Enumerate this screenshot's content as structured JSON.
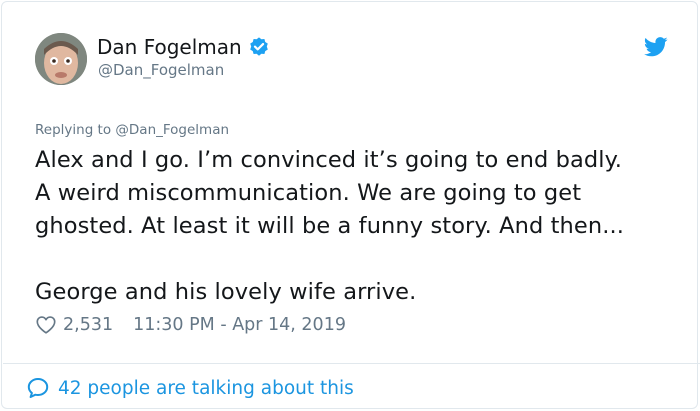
{
  "tweet": {
    "author": {
      "name": "Dan Fogelman",
      "handle": "@Dan_Fogelman",
      "verified": true
    },
    "replying_to_prefix": "Replying to",
    "replying_to_handle": "@Dan_Fogelman",
    "text_lines": [
      "Alex and I go. I’m convinced it’s going to end badly.",
      "A weird miscommunication.  We are going to get",
      "ghosted. At least it will be a funny story. And then...",
      "George and his lovely wife arrive."
    ],
    "likes": "2,531",
    "timestamp": "11:30 PM - Apr 14, 2019",
    "talking": "42 people are talking about this"
  },
  "colors": {
    "accent": "#1b95e0",
    "twitter_blue": "#1da1f2",
    "secondary_text": "#657786",
    "border": "#e1e8ed"
  },
  "icons": [
    "verified-badge-icon",
    "twitter-bird-icon",
    "heart-icon",
    "speech-bubble-icon"
  ]
}
